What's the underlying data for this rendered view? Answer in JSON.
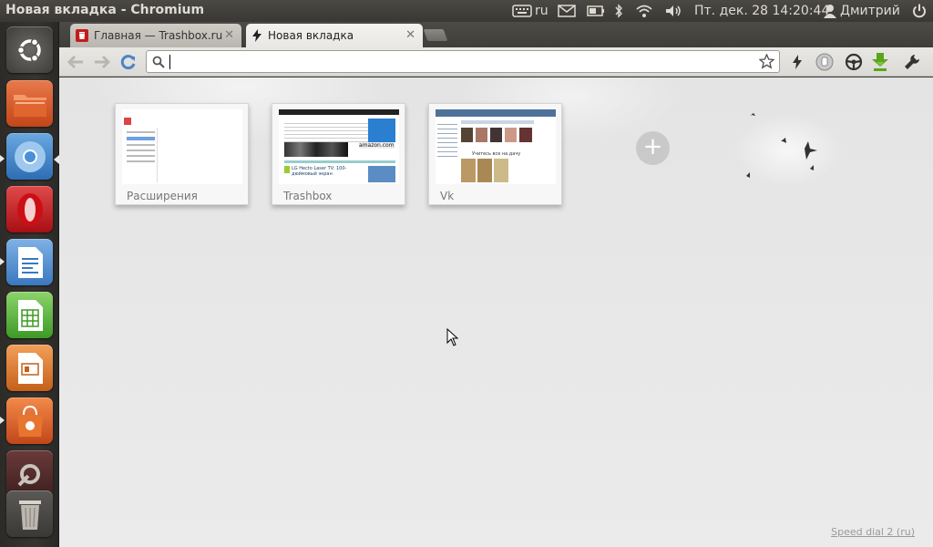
{
  "top_panel": {
    "window_title": "Новая вкладка - Chromium",
    "keyboard_layout": "ru",
    "datetime": "Пт. дек. 28 14:20:44",
    "user_name": "Дмитрий"
  },
  "launcher": {
    "items": [
      "ubuntu-dash",
      "files",
      "chromium",
      "opera",
      "libreoffice-writer",
      "libreoffice-calc",
      "libreoffice-impress",
      "software-center",
      "system-settings",
      "trash"
    ]
  },
  "browser": {
    "tabs": [
      {
        "label": "Главная — Trashbox.ru",
        "active": false
      },
      {
        "label": "Новая вкладка",
        "active": true
      }
    ],
    "omnibox": {
      "value": "",
      "placeholder": ""
    }
  },
  "speed_dial": {
    "dials": [
      {
        "title": "Расширения"
      },
      {
        "title": "Trashbox"
      },
      {
        "title": "Vk"
      }
    ],
    "add_label": "+",
    "footer_link": "Speed dial 2 (ru)"
  },
  "thumbnails": {
    "trashbox_headline": "LG Hecto Laser TV: 100-дюймовый экран",
    "trashbox_ad": "amazon.com",
    "vk_caption": "Учитесь все на дачу"
  },
  "colors": {
    "panel_bg": "#3c3b37",
    "accent_ubuntu": "#dd4814",
    "chromium_blue": "#4a90d9",
    "opera_red": "#cc0f16",
    "download_green": "#5aa51c"
  }
}
